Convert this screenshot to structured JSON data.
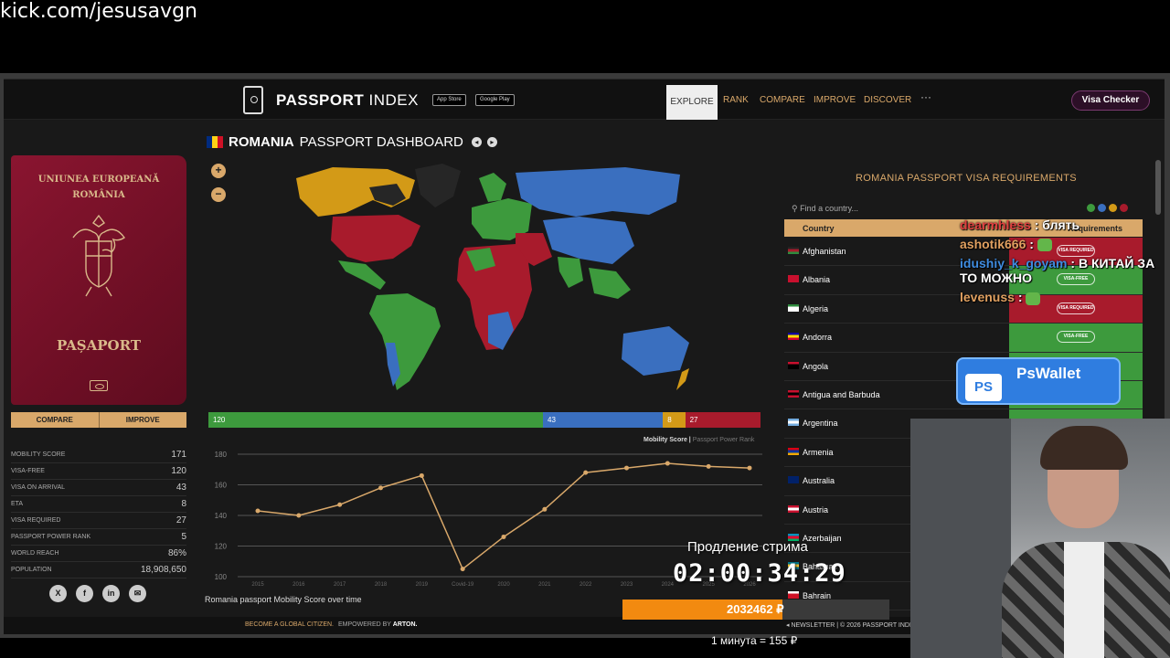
{
  "stream": {
    "url": "kick.com/jesusavgn",
    "chat": [
      {
        "user": "dearmhless",
        "sep": " : ",
        "text": "блять",
        "color": "red"
      },
      {
        "user": "ashotik666",
        "sep": " : ",
        "text": "",
        "emote": true,
        "color": "orange"
      },
      {
        "user": "idushiy_k_goyam",
        "sep": " : ",
        "text": "В КИТАЙ ЗА ТО МОЖНО",
        "color": "blue"
      },
      {
        "user": "levenuss",
        "sep": " : ",
        "text": "",
        "emote": true,
        "color": "orange"
      }
    ],
    "wallet": {
      "icon_text": "PS",
      "name": "PsWallet"
    },
    "subathon": {
      "label": "Продление стрима",
      "timer": "02:00:34:29",
      "amount": "2032462 ₽",
      "progress": 0.6,
      "rate": "1 минута = 155 ₽"
    }
  },
  "nav": {
    "logo_bold": "PASSPORT",
    "logo_thin": "INDEX",
    "app_store": "App Store",
    "google_play": "Google Play",
    "links": [
      "EXPLORE",
      "RANK",
      "COMPARE",
      "IMPROVE",
      "DISCOVER"
    ],
    "more": "···",
    "visa_checker": "Visa Checker"
  },
  "passport": {
    "line1": "UNIUNEA EUROPEANĂ",
    "line2": "ROMÂNIA",
    "label": "PAȘAPORT",
    "compare": "COMPARE",
    "improve": "IMPROVE"
  },
  "stats": [
    {
      "label": "MOBILITY SCORE",
      "value": "171"
    },
    {
      "label": "VISA-FREE",
      "value": "120"
    },
    {
      "label": "VISA ON ARRIVAL",
      "value": "43"
    },
    {
      "label": "ETA",
      "value": "8"
    },
    {
      "label": "VISA REQUIRED",
      "value": "27"
    },
    {
      "label": "PASSPORT POWER RANK",
      "value": "5"
    },
    {
      "label": "WORLD REACH",
      "value": "86%"
    },
    {
      "label": "POPULATION",
      "value": "18,908,650"
    }
  ],
  "socials": [
    "X",
    "f",
    "in",
    "✉"
  ],
  "dashboard": {
    "country": "ROMANIA",
    "suffix": "PASSPORT DASHBOARD",
    "zoom_in": "+",
    "zoom_out": "−"
  },
  "colors": {
    "visa_free": "#3d9a3d",
    "visa_on_arrival": "#3a6fbf",
    "eta": "#d39a17",
    "visa_required": "#a81b2c"
  },
  "breakdown": [
    {
      "key": "visa_free",
      "value": 120
    },
    {
      "key": "visa_on_arrival",
      "value": 43
    },
    {
      "key": "eta",
      "value": 8
    },
    {
      "key": "visa_required",
      "value": 27
    }
  ],
  "chart_data": {
    "type": "line",
    "title": "Romania passport Mobility Score over time",
    "legend_active": "Mobility Score",
    "legend_sep": " | ",
    "legend_inactive": "Passport Power Rank",
    "categories": [
      "2015",
      "2016",
      "2017",
      "2018",
      "2019",
      "Covid-19",
      "2020",
      "2021",
      "2022",
      "2023",
      "2024",
      "2025",
      "2026"
    ],
    "values": [
      143,
      140,
      147,
      158,
      166,
      105,
      126,
      144,
      168,
      171,
      174,
      172,
      171
    ],
    "ylim": [
      100,
      180
    ],
    "yticks": [
      100,
      120,
      140,
      160,
      180
    ],
    "grid": true,
    "color": "#d9a86a"
  },
  "visa_requirements": {
    "title": "ROMANIA PASSPORT VISA REQUIREMENTS",
    "search_placeholder": "Find a country...",
    "col_country": "Country",
    "col_requirements": "Requirements",
    "rows": [
      {
        "country": "Afghanistan",
        "req": "VISA REQUIRED",
        "status": "visa_required",
        "flag": [
          "#222",
          "#a81b2c",
          "#2e8b3d"
        ]
      },
      {
        "country": "Albania",
        "req": "VISA-FREE",
        "status": "visa_free",
        "flag": [
          "#c8102e",
          "#c8102e",
          "#c8102e"
        ]
      },
      {
        "country": "Algeria",
        "req": "VISA REQUIRED",
        "status": "visa_required",
        "flag": [
          "#2e8b3d",
          "#fff",
          "#fff"
        ]
      },
      {
        "country": "Andorra",
        "req": "VISA-FREE",
        "status": "visa_free",
        "flag": [
          "#10069f",
          "#fedd00",
          "#d50032"
        ]
      },
      {
        "country": "Angola",
        "req": "",
        "status": "visa_free",
        "flag": [
          "#c8102e",
          "#000",
          "#000"
        ]
      },
      {
        "country": "Antigua and Barbuda",
        "req": "",
        "status": "visa_free",
        "flag": [
          "#c8102e",
          "#000",
          "#c8102e"
        ]
      },
      {
        "country": "Argentina",
        "req": "",
        "status": "visa_free",
        "flag": [
          "#74acdf",
          "#fff",
          "#74acdf"
        ]
      },
      {
        "country": "Armenia",
        "req": "",
        "status": "visa_free",
        "flag": [
          "#d90012",
          "#0033a0",
          "#f2a800"
        ]
      },
      {
        "country": "Australia",
        "req": "",
        "status": "visa_free",
        "flag": [
          "#012169",
          "#012169",
          "#012169"
        ]
      },
      {
        "country": "Austria",
        "req": "",
        "status": "visa_free",
        "flag": [
          "#c8102e",
          "#fff",
          "#c8102e"
        ]
      },
      {
        "country": "Azerbaijan",
        "req": "",
        "status": "visa_free",
        "flag": [
          "#0092bc",
          "#e4002b",
          "#00af66"
        ]
      },
      {
        "country": "Bahamas",
        "req": "",
        "status": "visa_free",
        "flag": [
          "#00778b",
          "#ffc72c",
          "#00778b"
        ]
      },
      {
        "country": "Bahrain",
        "req": "",
        "status": "visa_free",
        "flag": [
          "#fff",
          "#ce1126",
          "#ce1126"
        ]
      }
    ]
  },
  "footer": {
    "citizen": "BECOME A GLOBAL CITIZEN.",
    "empowered": "EMPOWERED BY",
    "arton": "ARTON.",
    "newsletter": "◂ NEWSLETTER | © 2026 PASSPORT INDEX"
  }
}
